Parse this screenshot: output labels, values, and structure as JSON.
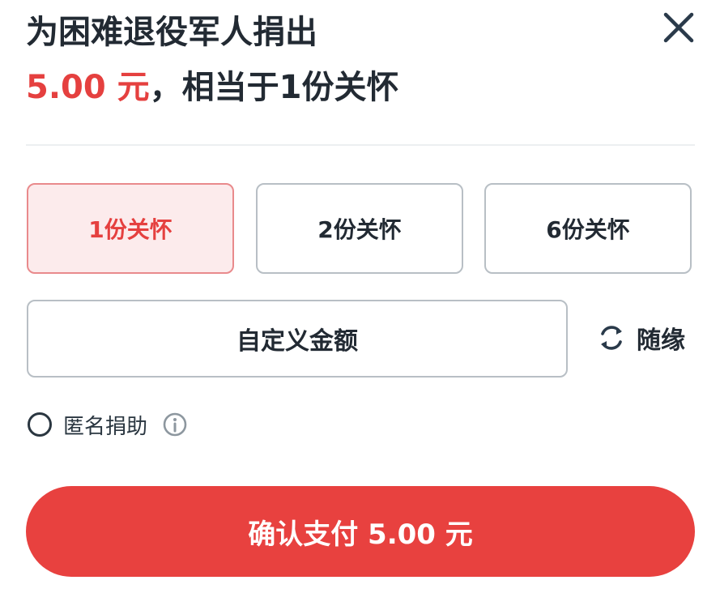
{
  "header": {
    "title": "为困难退役军人捐出",
    "amount": "5.00 元",
    "amount_suffix": "，相当于1份关怀"
  },
  "options": [
    {
      "label": "1份关怀",
      "selected": true
    },
    {
      "label": "2份关怀",
      "selected": false
    },
    {
      "label": "6份关怀",
      "selected": false
    }
  ],
  "custom_amount": {
    "label": "自定义金额"
  },
  "random": {
    "label": "随缘",
    "icon": "refresh-icon"
  },
  "anonymous": {
    "label": "匿名捐助",
    "checked": false,
    "info_icon": "info-icon"
  },
  "pay_button": {
    "label": "确认支付 5.00 元"
  },
  "colors": {
    "accent": "#e5403f",
    "accent_bg": "#fcebec",
    "button_bg": "#e8413f",
    "text": "#222a33",
    "border": "#b8bfc5"
  }
}
